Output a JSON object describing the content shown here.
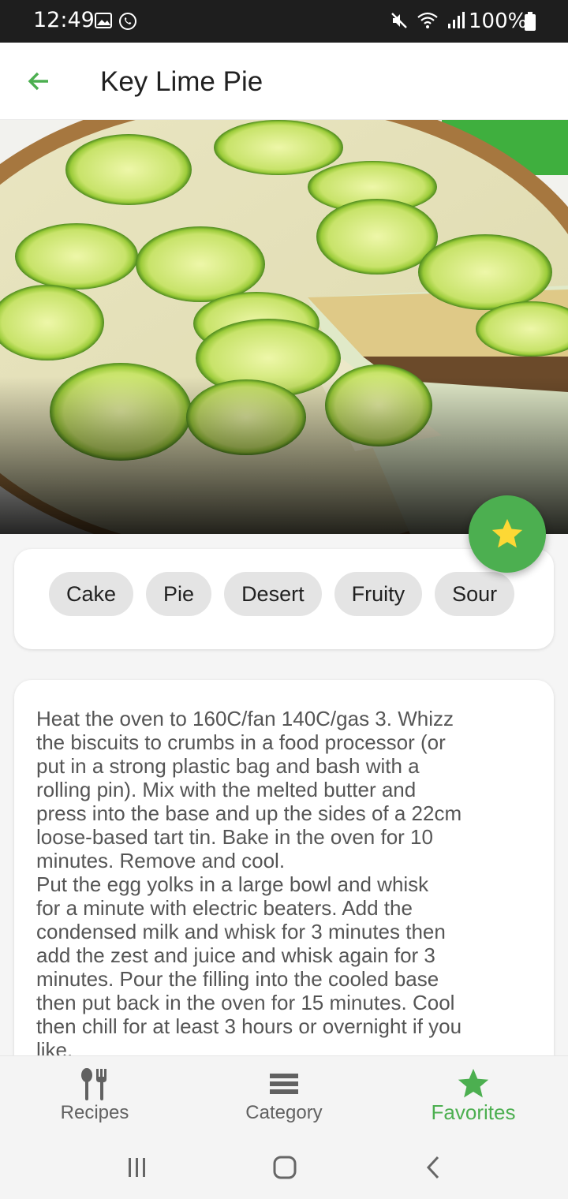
{
  "status_bar": {
    "time": "12:49",
    "battery": "100%"
  },
  "app_bar": {
    "title": "Key Lime Pie",
    "back_icon": "arrow-left-icon"
  },
  "fab": {
    "icon": "star-icon",
    "icon_color": "#fdd835",
    "background": "#4caf50"
  },
  "tags": [
    {
      "label": "Cake"
    },
    {
      "label": "Pie"
    },
    {
      "label": "Desert"
    },
    {
      "label": "Fruity"
    },
    {
      "label": "Sour"
    }
  ],
  "instructions": "Heat the oven to 160C/fan 140C/gas 3. Whizz\nthe biscuits to crumbs in a food processor (or\nput in a strong plastic bag and bash with a\nrolling pin). Mix with the melted butter and\npress into the base and up the sides of a 22cm\nloose-based tart tin. Bake in the oven for 10\nminutes. Remove and cool.\nPut the egg yolks in a large bowl and whisk\nfor a minute with electric beaters. Add the\ncondensed milk and whisk for 3 minutes then\nadd the zest and juice and whisk again for 3\nminutes. Pour the filling into the cooled base\nthen put back in the oven for 15 minutes. Cool\nthen chill for at least 3 hours or overnight if you\nlike.",
  "bottom_nav": {
    "items": [
      {
        "label": "Recipes",
        "icon": "cutlery-icon",
        "active": false
      },
      {
        "label": "Category",
        "icon": "list-icon",
        "active": false
      },
      {
        "label": "Favorites",
        "icon": "star-icon",
        "active": true
      }
    ],
    "active_color": "#4caf50"
  },
  "system_nav": [
    "recent-apps-icon",
    "home-icon",
    "back-icon"
  ]
}
